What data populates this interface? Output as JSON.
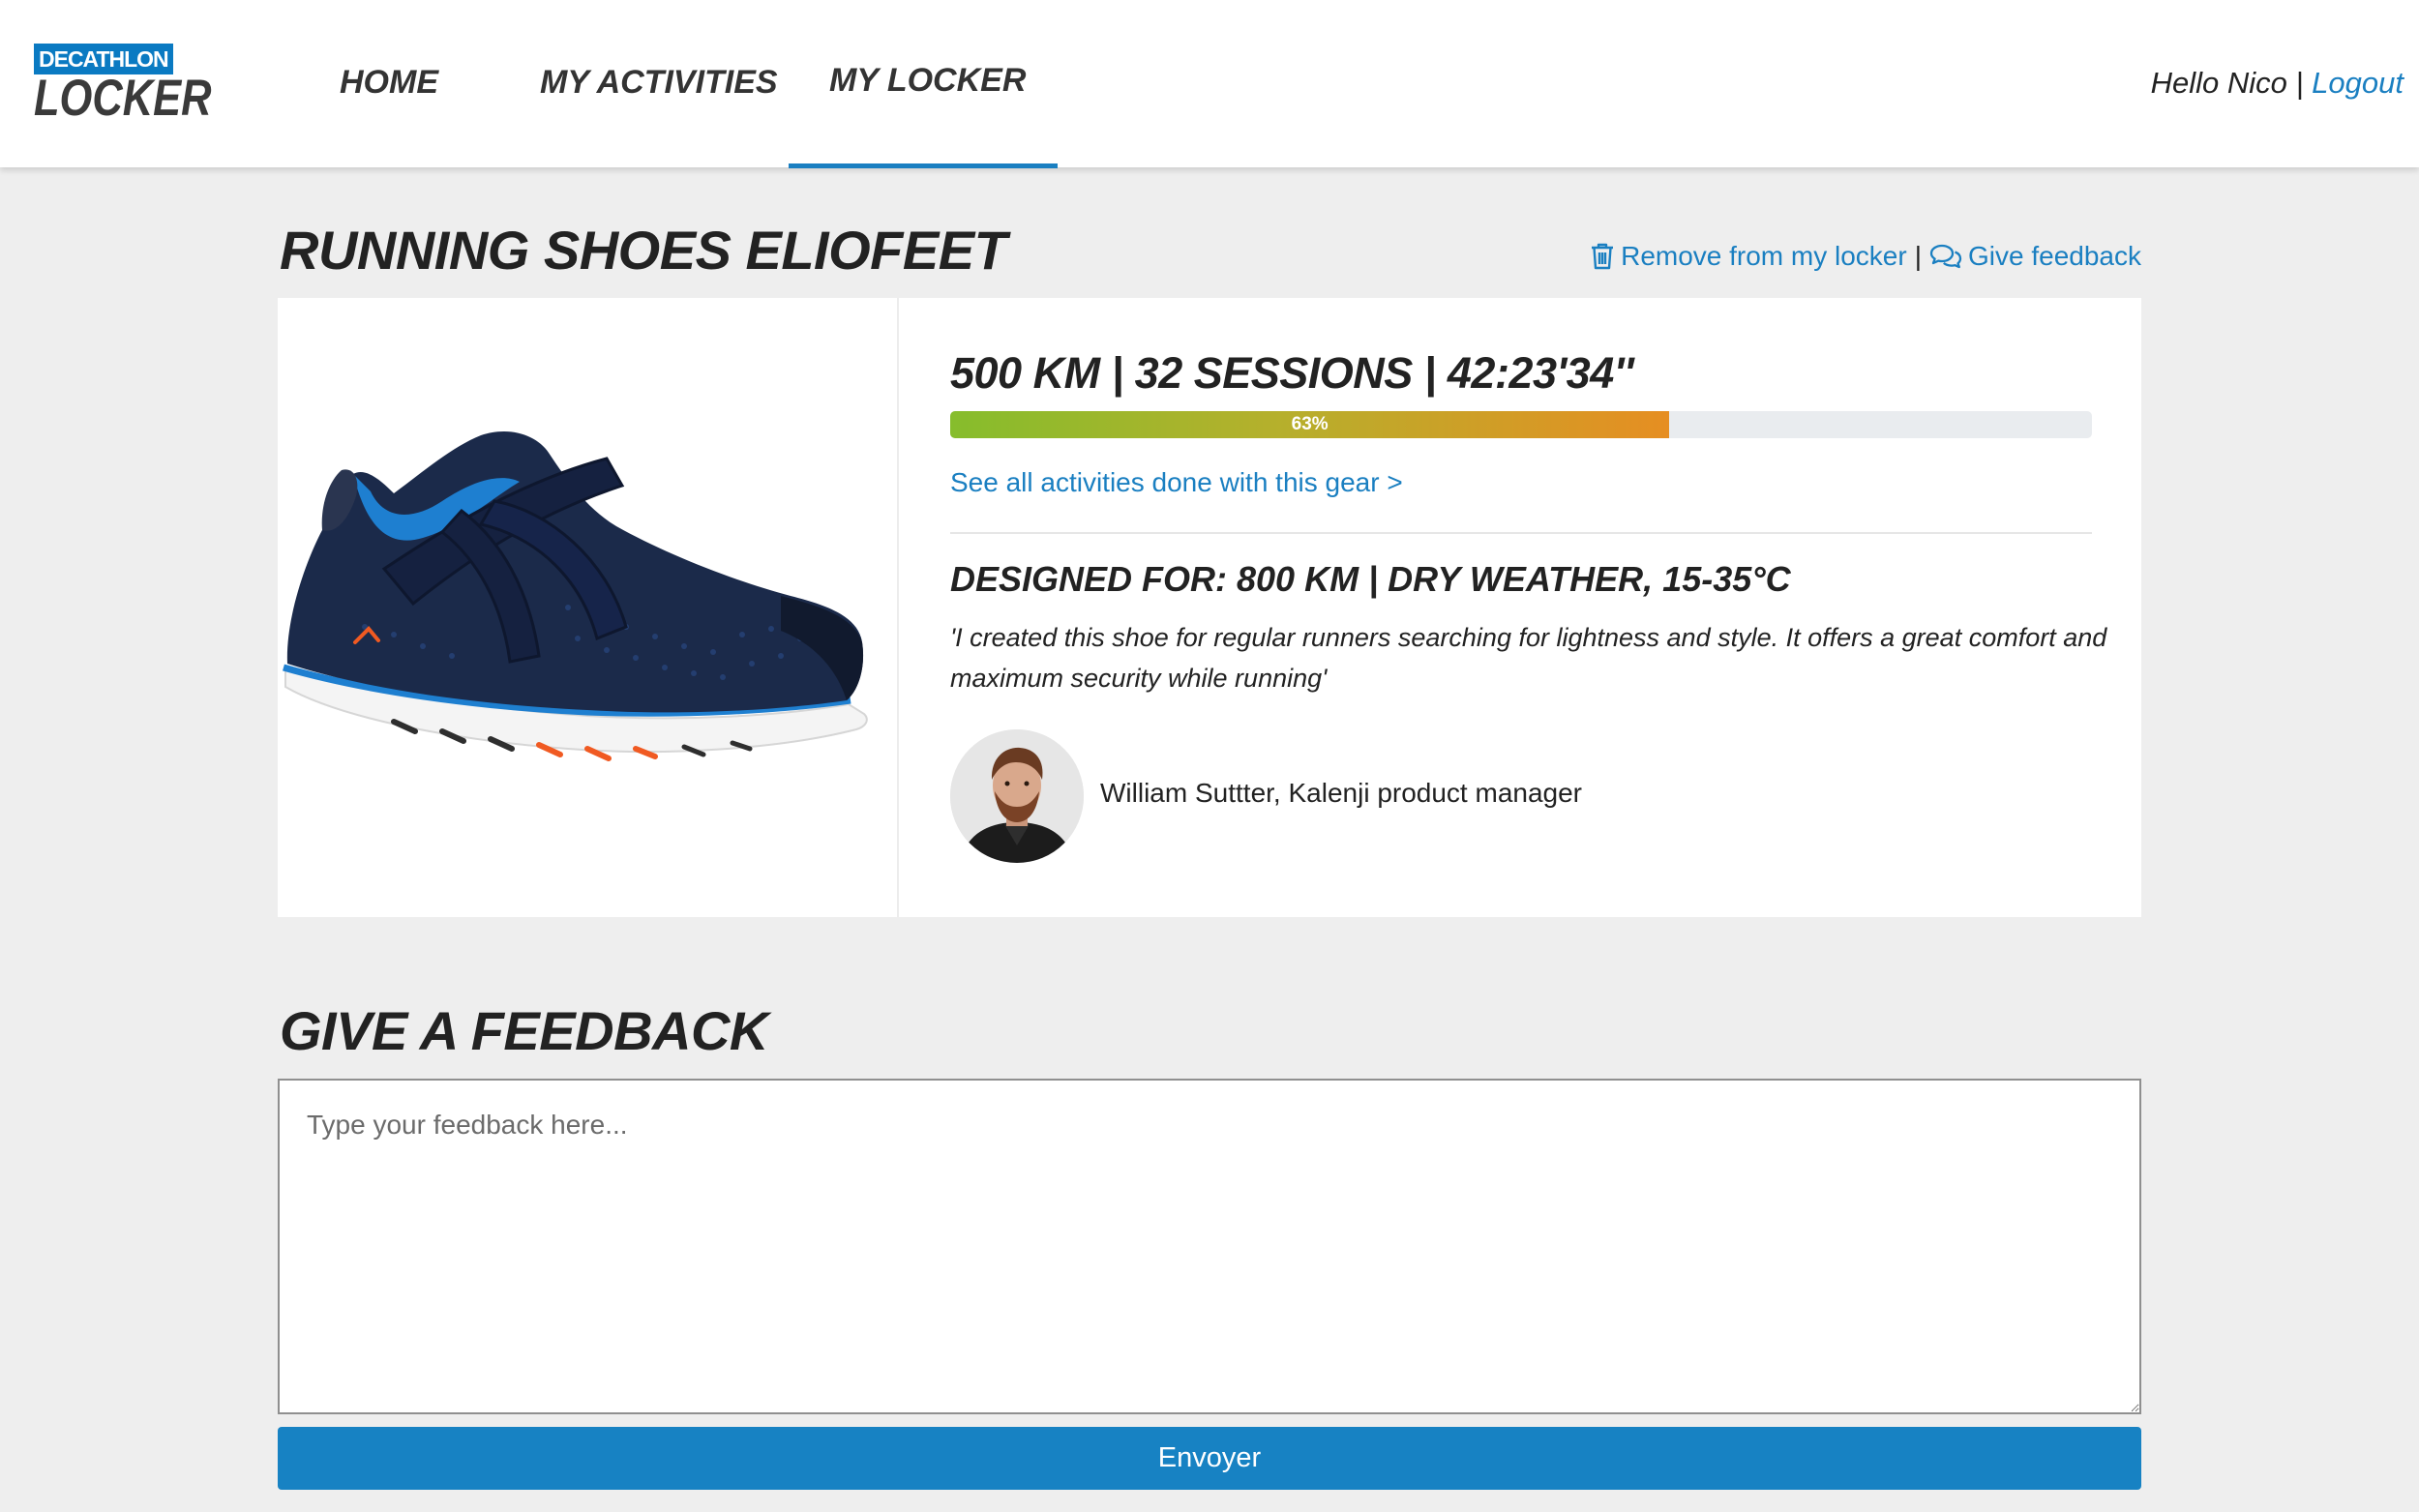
{
  "brand": {
    "badge": "DECATHLON",
    "name": "LOCKER",
    "accent_color": "#1a7fc1"
  },
  "nav": {
    "items": [
      {
        "label": "HOME"
      },
      {
        "label": "MY ACTIVITIES"
      },
      {
        "label": "MY LOCKER",
        "active": true
      }
    ]
  },
  "user": {
    "greeting": "Hello Nico",
    "separator": "|",
    "logout_label": "Logout"
  },
  "product": {
    "title": "RUNNING SHOES ELIOFEET",
    "actions": {
      "remove_label": "Remove from my locker",
      "remove_icon": "trash-icon",
      "separator": "|",
      "feedback_label": "Give feedback",
      "feedback_icon": "chat-bubbles-icon"
    },
    "image_icon": "running-shoe-image",
    "stats": "500 KM | 32 SESSIONS | 42:23'34''",
    "progress": {
      "percent": 63,
      "label": "63%"
    },
    "see_all_label": "See all activities done with this gear >",
    "designed_for": "DESIGNED FOR: 800 KM | DRY WEATHER, 15-35°C",
    "quote": "'I created this shoe for regular runners searching for lightness and style. It offers a great comfort and maximum security while running'",
    "manager": {
      "avatar_icon": "manager-avatar",
      "caption": "William Suttter, Kalenji product manager"
    }
  },
  "feedback": {
    "title": "GIVE A FEEDBACK",
    "value": "",
    "placeholder": "Type your feedback here...",
    "submit_label": "Envoyer"
  }
}
